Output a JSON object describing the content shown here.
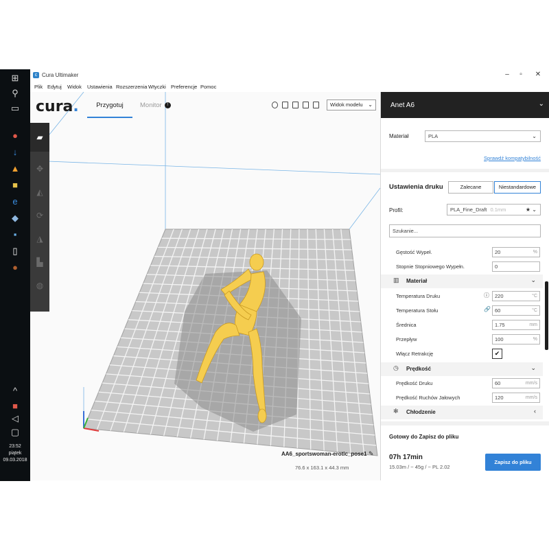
{
  "window": {
    "title": "Cura Ultimaker",
    "minimize": "–",
    "maximize": "▫",
    "close": "✕"
  },
  "menu": {
    "items": [
      "Plik",
      "Edytuj",
      "Widok",
      "Ustawienia",
      "Rozszerzenia",
      "Wtyczki",
      "Preferencje",
      "Pomoc"
    ]
  },
  "taskbar": {
    "time": "23:52",
    "day": "piątek",
    "date": "09.03.2018"
  },
  "header": {
    "logo": "cura",
    "logo_dot": ".",
    "tab_prepare": "Przygotuj",
    "tab_monitor": "Monitor",
    "monitor_badge": "!",
    "view_mode": "Widok modelu"
  },
  "model": {
    "name": "AA6_sportswoman-erotic_pose1",
    "dimensions": "76.6 x 163.1 x 44.3 mm"
  },
  "sidebar": {
    "printer": "Anet A6",
    "material_label": "Materiał",
    "material_value": "PLA",
    "compat_link": "Sprawdź kompatybilność",
    "settings_title": "Ustawienia druku",
    "mode_recommended": "Zalecane",
    "mode_custom": "Niestandardowe",
    "profile_label": "Profil:",
    "profile_value": "PLA_Fine_Draft",
    "profile_hint": "0.1mm",
    "search_placeholder": "Szukanie...",
    "rows": [
      {
        "kind": "setting",
        "label": "Gęstość Wypeł.",
        "value": "20",
        "unit": "%"
      },
      {
        "kind": "setting",
        "label": "Stopnie Stopniowego Wypełn.",
        "value": "0",
        "unit": ""
      },
      {
        "kind": "category",
        "label": "Materiał",
        "icon": "▥",
        "chevron": "⌄"
      },
      {
        "kind": "setting",
        "label": "Temperatura Druku",
        "value": "220",
        "unit": "°C",
        "side": "ⓘ"
      },
      {
        "kind": "setting",
        "label": "Temperatura Stołu",
        "value": "60",
        "unit": "°C",
        "side": "🔗"
      },
      {
        "kind": "setting",
        "label": "Średnica",
        "value": "1.75",
        "unit": "mm"
      },
      {
        "kind": "setting",
        "label": "Przepływ",
        "value": "100",
        "unit": "%"
      },
      {
        "kind": "check",
        "label": "Włącz Retrakcję",
        "value": "✔"
      },
      {
        "kind": "category",
        "label": "Prędkość",
        "icon": "◷",
        "chevron": "⌄"
      },
      {
        "kind": "setting",
        "label": "Prędkość Druku",
        "value": "60",
        "unit": "mm/s"
      },
      {
        "kind": "setting",
        "label": "Prędkość Ruchów Jałowych",
        "value": "120",
        "unit": "mm/s"
      },
      {
        "kind": "category",
        "label": "Chłodzenie",
        "icon": "✻",
        "chevron": "‹"
      }
    ],
    "ready_text": "Gotowy do Zapisz do pliku",
    "print_time": "07h 17min",
    "material_usage": "15.03m / ~ 45g / ~ PL 2.02",
    "save_button": "Zapisz do pliku"
  },
  "colors": {
    "accent": "#3282d7",
    "model": "#f5cd4f",
    "dark_header": "#222222"
  }
}
